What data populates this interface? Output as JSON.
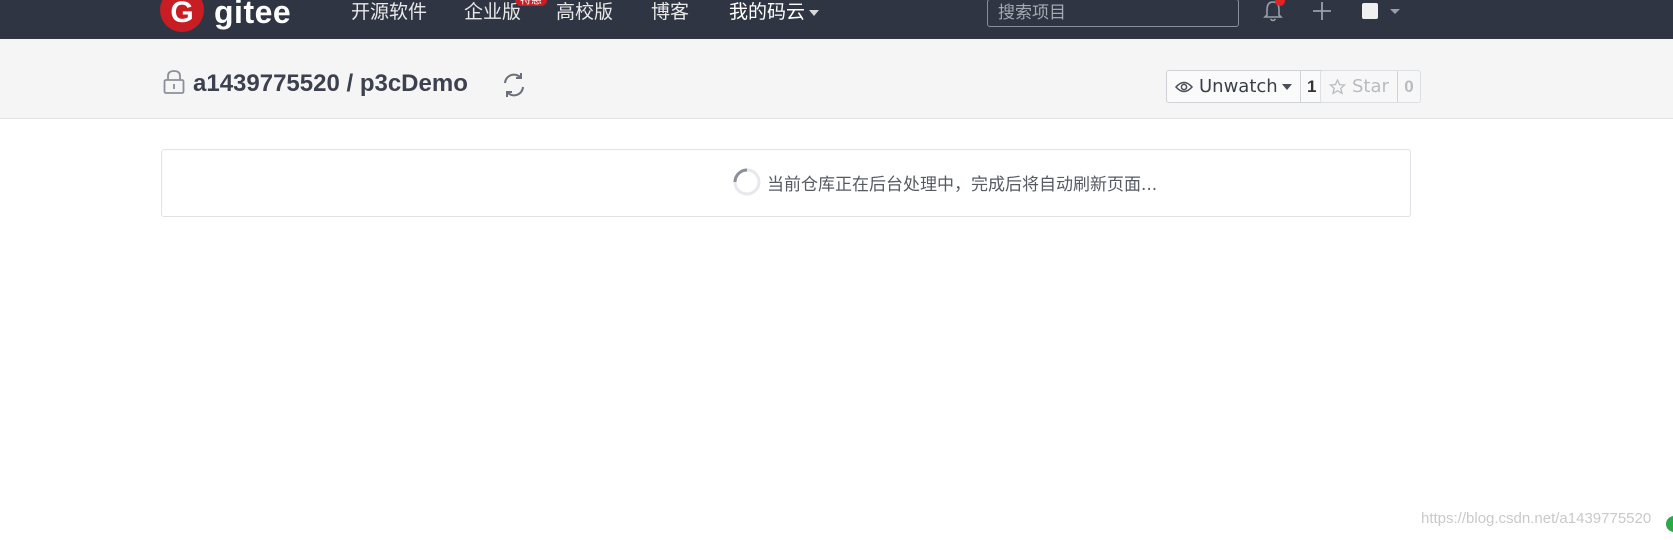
{
  "nav": {
    "logo_letter": "G",
    "logo_text": "gitee",
    "items": [
      {
        "label": "开源软件"
      },
      {
        "label": "企业版"
      },
      {
        "label": "高校版"
      },
      {
        "label": "博客"
      },
      {
        "label": "我的码云"
      }
    ],
    "enterprise_badge": "特惠",
    "search_placeholder": "搜索项目",
    "icons": [
      "bell-icon",
      "plus-icon",
      "avatar",
      "chevron-down-icon"
    ]
  },
  "project": {
    "owner": "a1439775520",
    "separator": "/",
    "name": "p3cDemo",
    "title": "a1439775520 / p3cDemo",
    "visibility_icon": "lock-icon",
    "sync_icon": "sync-icon"
  },
  "actions": {
    "watch": {
      "label": "Unwatch",
      "count": "1"
    },
    "star": {
      "label": "Star",
      "count": "0"
    }
  },
  "status": {
    "message": "当前仓库正在后台处理中，完成后将自动刷新页面..."
  },
  "watermark": "https://blog.csdn.net/a1439775520",
  "colors": {
    "nav_bg": "#2f3542",
    "brand_red": "#c71d23",
    "header_bg": "#f5f5f5"
  }
}
